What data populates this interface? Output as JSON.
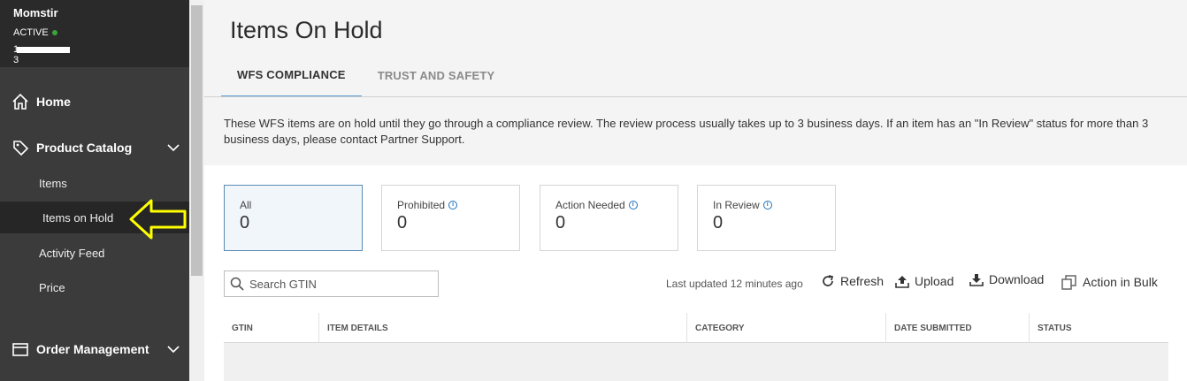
{
  "sidebar": {
    "store_name": "Momstir",
    "status": "ACTIVE",
    "store_id_prefix": "1",
    "store_id_suffix": "3",
    "home_label": "Home",
    "product_catalog_label": "Product Catalog",
    "items": [
      {
        "label": "Items"
      },
      {
        "label": "Items on Hold"
      },
      {
        "label": "Activity Feed"
      },
      {
        "label": "Price"
      }
    ],
    "order_management_label": "Order Management",
    "colors": {
      "status_dot": "#3aa63a",
      "annotation_arrow": "#ffff00"
    }
  },
  "main": {
    "title": "Items On Hold",
    "tabs": [
      {
        "label": "WFS COMPLIANCE",
        "active": true
      },
      {
        "label": "TRUST AND SAFETY",
        "active": false
      }
    ],
    "notice": "These WFS items are on hold until they go through a compliance review. The review process usually takes up to 3 business days. If an item has an \"In Review\" status for more than 3 business days, please contact Partner Support.",
    "cards": [
      {
        "label": "All",
        "count": "0",
        "info": false,
        "active": true
      },
      {
        "label": "Prohibited",
        "count": "0",
        "info": true,
        "active": false
      },
      {
        "label": "Action Needed",
        "count": "0",
        "info": true,
        "active": false
      },
      {
        "label": "In Review",
        "count": "0",
        "info": true,
        "active": false
      }
    ],
    "search_placeholder": "Search GTIN",
    "last_updated": "Last updated 12 minutes ago",
    "toolbar": {
      "refresh": "Refresh",
      "upload": "Upload",
      "download": "Download",
      "action_in_bulk": "Action in Bulk"
    },
    "columns": [
      "GTIN",
      "ITEM DETAILS",
      "CATEGORY",
      "DATE SUBMITTED",
      "STATUS"
    ]
  }
}
